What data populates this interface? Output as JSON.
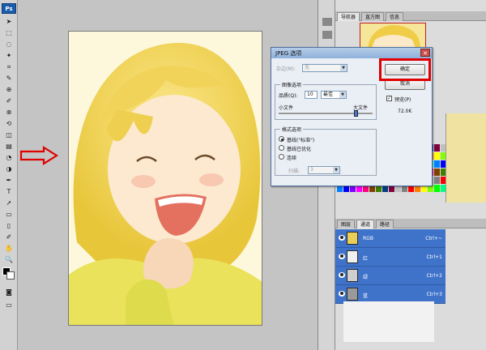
{
  "app": {
    "logo": "Ps"
  },
  "colors": {
    "accent_red": "#e00000",
    "layer_selected": "#3f73c9",
    "dialog_bg": "#eaeef5"
  },
  "tools": [
    "move-tool",
    "marquee-tool",
    "lasso-tool",
    "wand-tool",
    "crop-tool",
    "eyedropper-tool",
    "heal-tool",
    "brush-tool",
    "stamp-tool",
    "history-brush-tool",
    "eraser-tool",
    "gradient-tool",
    "blur-tool",
    "dodge-tool",
    "pen-tool",
    "type-tool",
    "path-select-tool",
    "shape-tool",
    "notes-tool",
    "eyedropper2-tool",
    "hand-tool",
    "zoom-tool"
  ],
  "panels": {
    "nav_tabs": [
      "导航器",
      "直方图",
      "信息"
    ],
    "layer_tabs": [
      "图层",
      "通道",
      "路径"
    ],
    "channels": [
      {
        "name": "RGB",
        "key": "Ctrl+~"
      },
      {
        "name": "红",
        "key": "Ctrl+1"
      },
      {
        "name": "绿",
        "key": "Ctrl+2"
      },
      {
        "name": "蓝",
        "key": "Ctrl+3"
      }
    ]
  },
  "dialog": {
    "title": "JPEG 选项",
    "matte": {
      "label": "杂边(M):",
      "value": "无"
    },
    "image_options": {
      "title": "图像选项",
      "quality_label": "品质(Q):",
      "quality_value": "10",
      "quality_preset": "最佳",
      "small_file": "小文件",
      "large_file": "大文件",
      "slider_position": 0.83
    },
    "format_options": {
      "title": "格式选项",
      "options": [
        "基线(\"标准\")",
        "基线已优化",
        "连续"
      ],
      "selected_index": 0,
      "scan_label": "扫描:",
      "scan_value": "3"
    },
    "ok_label": "确定",
    "cancel_label": "取消",
    "preview_label": "预览(P)",
    "preview_checked": true,
    "file_size": "72.0K"
  }
}
